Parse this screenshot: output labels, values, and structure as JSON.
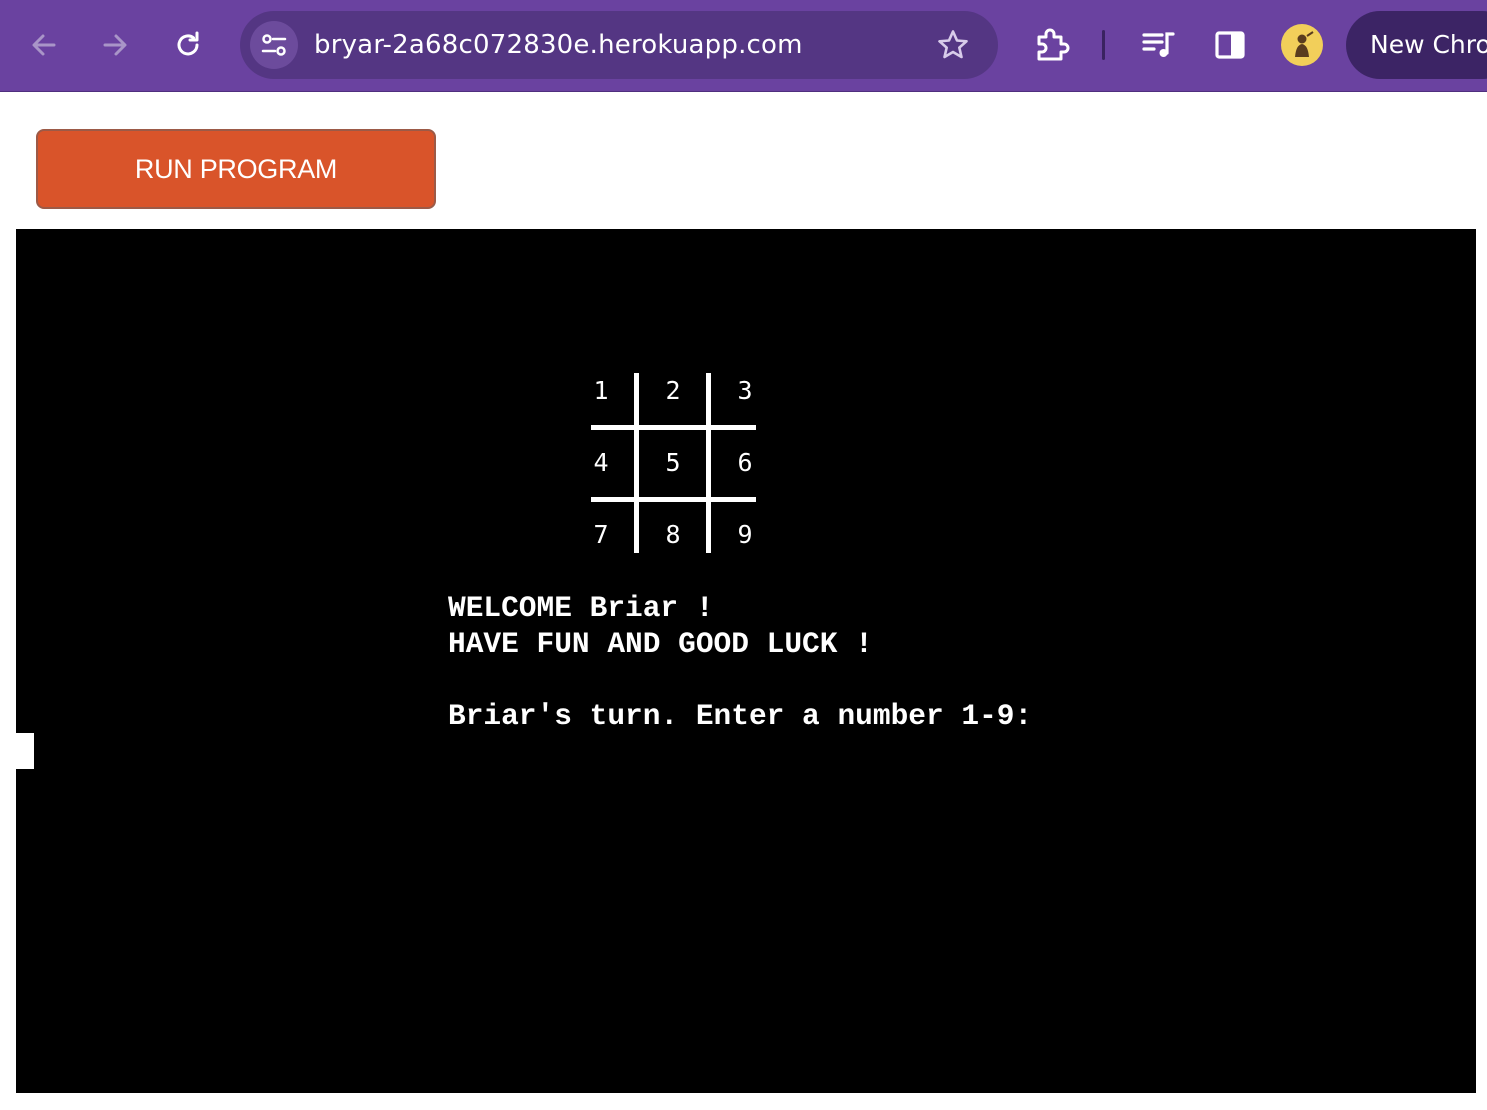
{
  "browser": {
    "url": "bryar-2a68c072830e.herokuapp.com",
    "new_chrome_label": "New Chro",
    "theme_color": "#6a42a0"
  },
  "page": {
    "run_button_label": "RUN PROGRAM",
    "run_button_color": "#d9542a"
  },
  "terminal": {
    "board": [
      "1",
      "2",
      "3",
      "4",
      "5",
      "6",
      "7",
      "8",
      "9"
    ],
    "welcome_line": "WELCOME Briar !",
    "fun_line": "HAVE FUN AND GOOD LUCK !",
    "prompt_line": "Briar's turn. Enter a number 1-9:"
  }
}
